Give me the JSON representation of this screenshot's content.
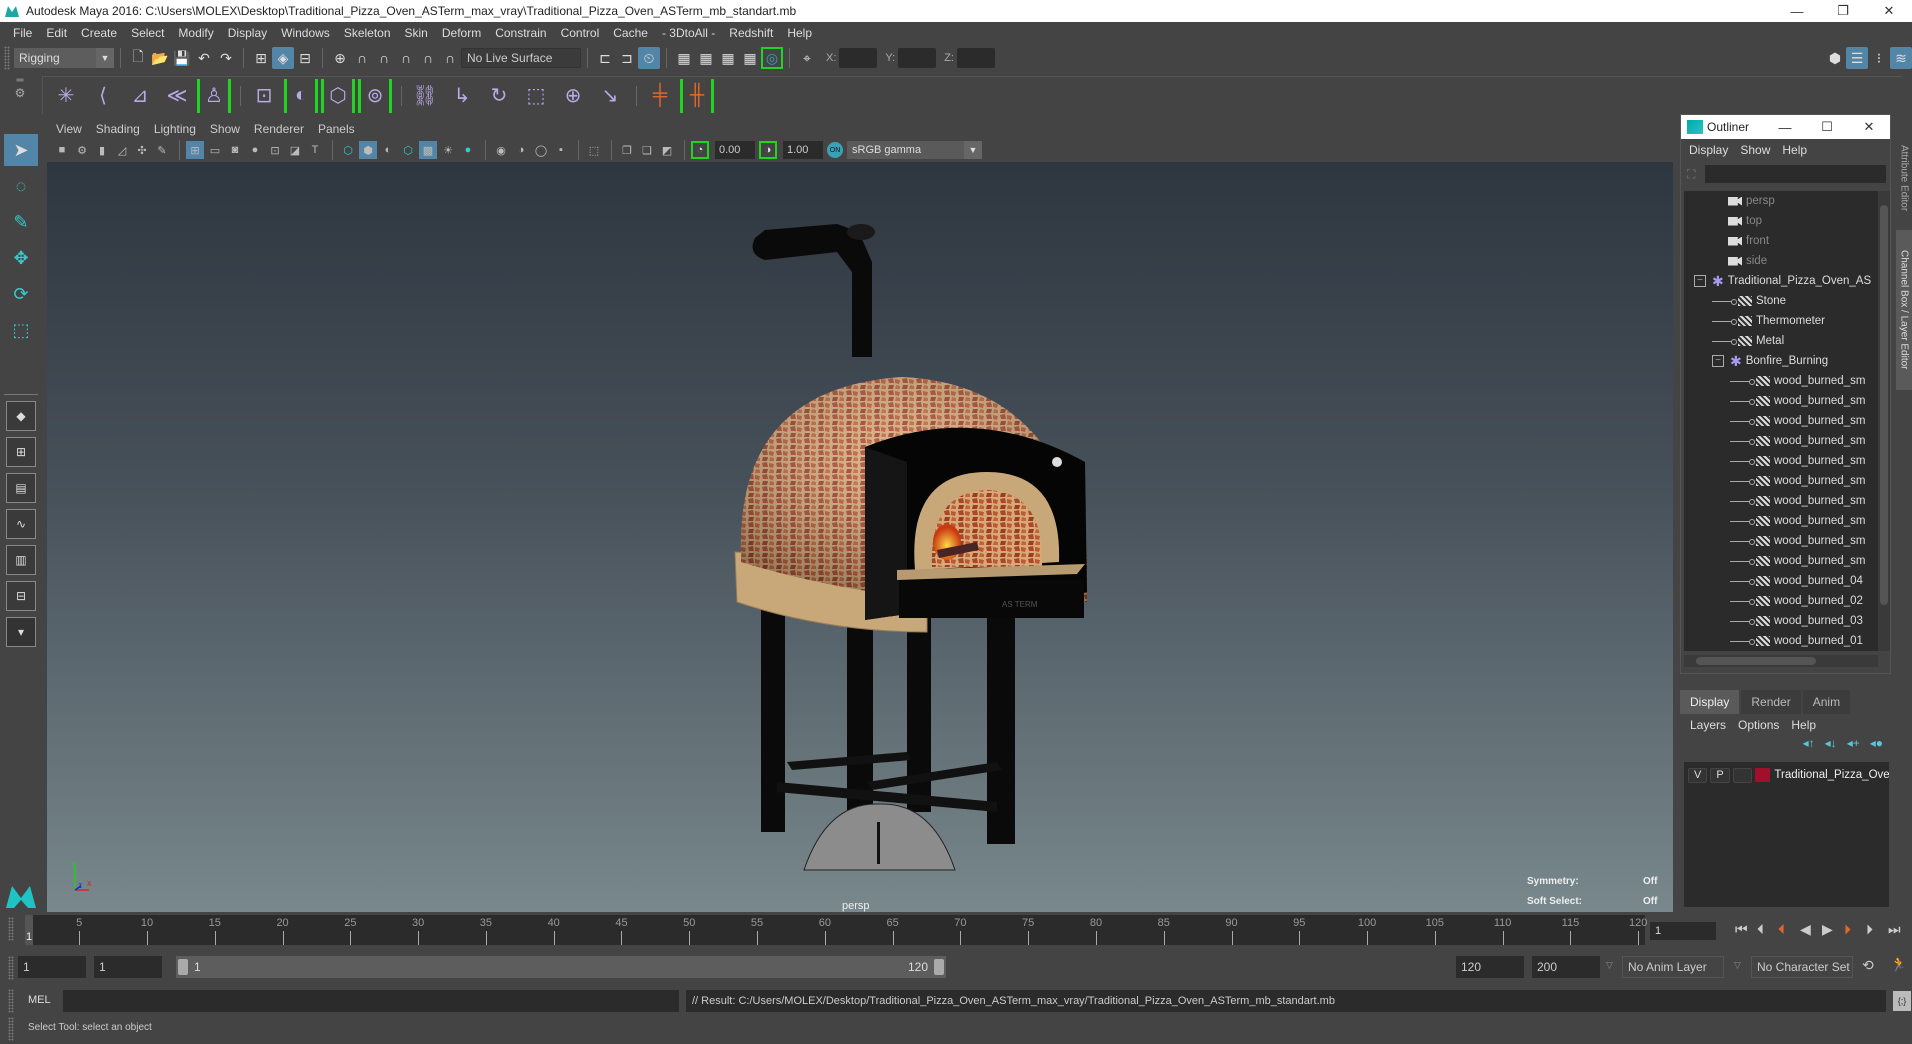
{
  "window": {
    "title": "Autodesk Maya 2016: C:\\Users\\MOLEX\\Desktop\\Traditional_Pizza_Oven_ASTerm_max_vray\\Traditional_Pizza_Oven_ASTerm_mb_standart.mb",
    "controls": {
      "minimize": "—",
      "restore": "❐",
      "close": "✕"
    }
  },
  "menubar": [
    "File",
    "Edit",
    "Create",
    "Select",
    "Modify",
    "Display",
    "Windows",
    "Skeleton",
    "Skin",
    "Deform",
    "Constrain",
    "Control",
    "Cache",
    "- 3DtoAll -",
    "Redshift",
    "Help"
  ],
  "statusline": {
    "menu_set": "Rigging",
    "live_surface": "No Live Surface",
    "x_label": "X:",
    "y_label": "Y:",
    "z_label": "Z:",
    "x_value": "",
    "y_value": "",
    "z_value": ""
  },
  "shelf": {
    "icons": [
      "joint-tool",
      "ik-handle",
      "ik-spline",
      "insert-joint",
      "quick-rig",
      "skin-paint",
      "bind-skin",
      "lattice",
      "cluster",
      "parent-constraint",
      "point-constraint",
      "orient-constraint",
      "scale-constraint",
      "aim-constraint",
      "pole-vector",
      "key-pose",
      "set-key"
    ]
  },
  "toolbox": {
    "tools": [
      "select-tool",
      "lasso-tool",
      "paint-select-tool",
      "move-tool",
      "rotate-tool",
      "scale-tool"
    ],
    "layouts": [
      "single-pane",
      "four-pane",
      "outliner-persp",
      "graph-persp",
      "hypershade-persp",
      "multi-pane",
      "more-layouts"
    ]
  },
  "viewport": {
    "menus": [
      "View",
      "Shading",
      "Lighting",
      "Show",
      "Renderer",
      "Panels"
    ],
    "exposure": "0.00",
    "gamma": "1.00",
    "color_space": "sRGB gamma",
    "camera": "persp",
    "hud": {
      "symmetry_label": "Symmetry:",
      "symmetry_value": "Off",
      "soft_select_label": "Soft Select:",
      "soft_select_value": "Off"
    },
    "axis": {
      "y": "y",
      "x": "x",
      "z": "z"
    }
  },
  "outliner": {
    "title": "Outliner",
    "menus": [
      "Display",
      "Show",
      "Help"
    ],
    "filter_value": "",
    "items": [
      {
        "label": "persp",
        "type": "camera",
        "depth": 0
      },
      {
        "label": "top",
        "type": "camera",
        "depth": 0
      },
      {
        "label": "front",
        "type": "camera",
        "depth": 0
      },
      {
        "label": "side",
        "type": "camera",
        "depth": 0
      },
      {
        "label": "Traditional_Pizza_Oven_AS",
        "type": "group",
        "depth": 0,
        "expanded": true
      },
      {
        "label": "Stone",
        "type": "mesh",
        "depth": 1
      },
      {
        "label": "Thermometer",
        "type": "mesh",
        "depth": 1
      },
      {
        "label": "Metal",
        "type": "mesh",
        "depth": 1
      },
      {
        "label": "Bonfire_Burning",
        "type": "group",
        "depth": 1,
        "expanded": true
      },
      {
        "label": "wood_burned_sm",
        "type": "mesh",
        "depth": 2
      },
      {
        "label": "wood_burned_sm",
        "type": "mesh",
        "depth": 2
      },
      {
        "label": "wood_burned_sm",
        "type": "mesh",
        "depth": 2
      },
      {
        "label": "wood_burned_sm",
        "type": "mesh",
        "depth": 2
      },
      {
        "label": "wood_burned_sm",
        "type": "mesh",
        "depth": 2
      },
      {
        "label": "wood_burned_sm",
        "type": "mesh",
        "depth": 2
      },
      {
        "label": "wood_burned_sm",
        "type": "mesh",
        "depth": 2
      },
      {
        "label": "wood_burned_sm",
        "type": "mesh",
        "depth": 2
      },
      {
        "label": "wood_burned_sm",
        "type": "mesh",
        "depth": 2
      },
      {
        "label": "wood_burned_sm",
        "type": "mesh",
        "depth": 2
      },
      {
        "label": "wood_burned_04",
        "type": "mesh",
        "depth": 2
      },
      {
        "label": "wood_burned_02",
        "type": "mesh",
        "depth": 2
      },
      {
        "label": "wood_burned_03",
        "type": "mesh",
        "depth": 2
      },
      {
        "label": "wood_burned_01",
        "type": "mesh",
        "depth": 2
      }
    ]
  },
  "side_tabs": {
    "attribute_editor": "Attribute Editor",
    "channel_box": "Channel Box / Layer Editor"
  },
  "layer_editor": {
    "tabs": [
      "Display",
      "Render",
      "Anim"
    ],
    "active_tab": "Display",
    "menus": [
      "Layers",
      "Options",
      "Help"
    ],
    "layers": [
      {
        "visible": "V",
        "playback": "P",
        "name": "Traditional_Pizza_Over",
        "color": "#a0102c"
      }
    ]
  },
  "timeline": {
    "ticks": [
      5,
      10,
      15,
      20,
      25,
      30,
      35,
      40,
      45,
      50,
      55,
      60,
      65,
      70,
      75,
      80,
      85,
      90,
      95,
      100,
      105,
      110,
      115,
      120
    ],
    "current_marker": "1",
    "current_frame": "1",
    "range_start": "1",
    "playback_start": "1",
    "range_min_label": "1",
    "range_max_label": "120",
    "playback_end": "120",
    "range_end": "200",
    "anim_layer": "No Anim Layer",
    "character_set": "No Character Set"
  },
  "command_line": {
    "language": "MEL",
    "input_value": "",
    "result": "// Result: C:/Users/MOLEX/Desktop/Traditional_Pizza_Oven_ASTerm_max_vray/Traditional_Pizza_Oven_ASTerm_mb_standart.mb"
  },
  "help_line": "Select Tool: select an object",
  "colors": {
    "accent": "#5285a6",
    "highlight_green": "#22d422",
    "layer_red": "#a0102c"
  }
}
